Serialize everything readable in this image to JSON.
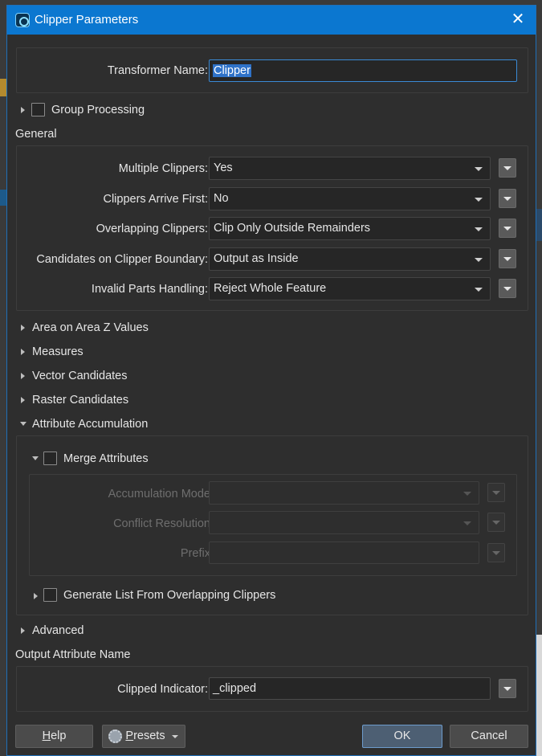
{
  "dialog": {
    "title": "Clipper Parameters"
  },
  "transformer": {
    "label": "Transformer Name:",
    "value": "Clipper"
  },
  "group_processing": {
    "label": "Group Processing"
  },
  "general": {
    "header": "General",
    "rows": [
      {
        "label": "Multiple Clippers:",
        "value": "Yes"
      },
      {
        "label": "Clippers Arrive First:",
        "value": "No"
      },
      {
        "label": "Overlapping Clippers:",
        "value": "Clip Only Outside Remainders"
      },
      {
        "label": "Candidates on Clipper Boundary:",
        "value": "Output as Inside"
      },
      {
        "label": "Invalid Parts Handling:",
        "value": "Reject Whole Feature"
      }
    ]
  },
  "sections": {
    "area_z": "Area on Area Z Values",
    "measures": "Measures",
    "vector": "Vector Candidates",
    "raster": "Raster Candidates",
    "attr_accum": "Attribute Accumulation",
    "advanced": "Advanced"
  },
  "merge": {
    "label": "Merge Attributes",
    "accum_mode": "Accumulation Mode:",
    "conflict": "Conflict Resolution:",
    "prefix": "Prefix:"
  },
  "generate_list": {
    "label": "Generate List From Overlapping Clippers"
  },
  "output": {
    "header": "Output Attribute Name",
    "label": "Clipped Indicator:",
    "value": "_clipped"
  },
  "buttons": {
    "help_h": "H",
    "help_rest": "elp",
    "presets_p": "P",
    "presets_rest": "resets",
    "ok": "OK",
    "cancel": "Cancel"
  }
}
